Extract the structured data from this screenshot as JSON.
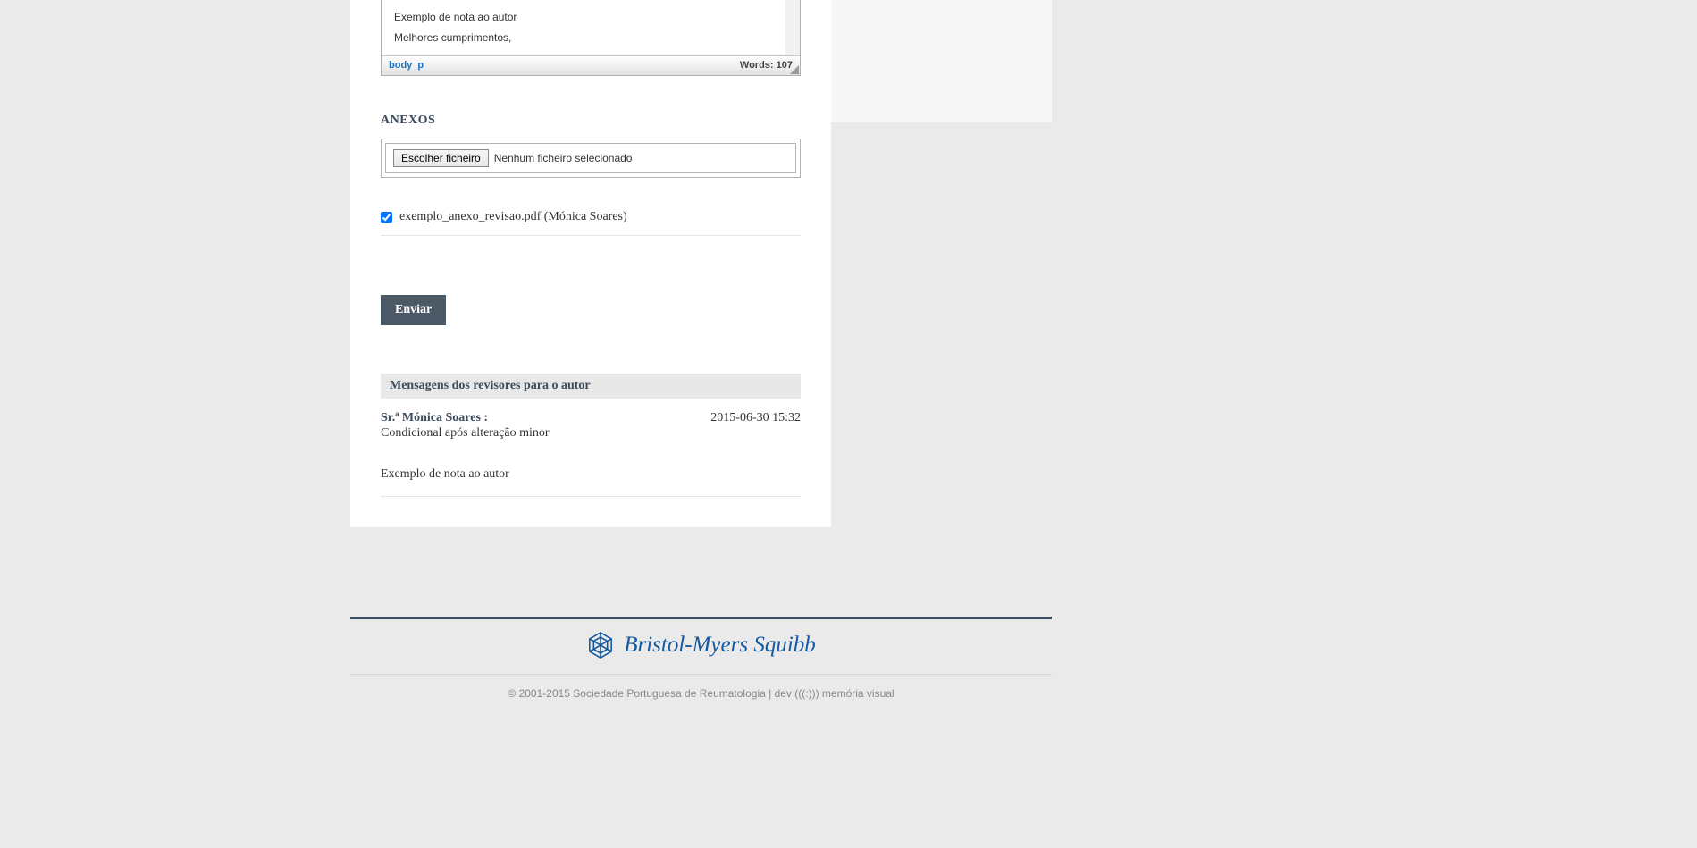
{
  "editor": {
    "line1": "Exemplo de nota ao autor",
    "line2": "Melhores cumprimentos,",
    "path_body": "body",
    "path_p": "p",
    "words_label": "Words: 107"
  },
  "attachments": {
    "heading": "ANEXOS",
    "button_label": "Escolher ficheiro",
    "status": "Nenhum ficheiro selecionado",
    "file_label": "exemplo_anexo_revisao.pdf (Mónica Soares)"
  },
  "submit_label": "Enviar",
  "messages": {
    "heading": "Mensagens dos revisores para o autor",
    "item": {
      "author": "Sr.ª Mónica Soares :",
      "date": "2015-06-30 15:32",
      "subtitle": "Condicional após alteração minor",
      "body": "Exemplo de nota ao autor"
    }
  },
  "footer": {
    "sponsor": "Bristol-Myers Squibb",
    "copyright": "© 2001-2015 Sociedade Portuguesa de Reumatologia | dev (((:))) memória visual"
  }
}
